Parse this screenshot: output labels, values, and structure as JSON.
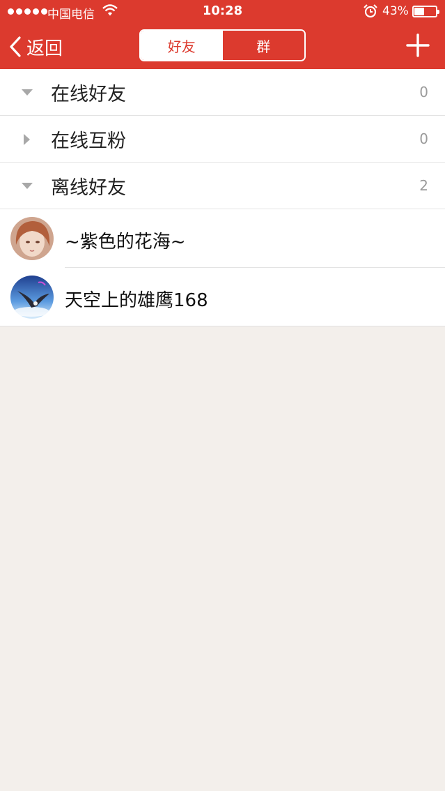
{
  "status": {
    "carrier": "中国电信",
    "time": "10:28",
    "battery": "43%",
    "battery_level": 0.43
  },
  "nav": {
    "back_label": "返回",
    "tabs": [
      {
        "label": "好友",
        "active": true
      },
      {
        "label": "群",
        "active": false
      }
    ]
  },
  "groups": [
    {
      "name": "在线好友",
      "count": "0",
      "expanded": true
    },
    {
      "name": "在线互粉",
      "count": "0",
      "expanded": false
    },
    {
      "name": "离线好友",
      "count": "2",
      "expanded": true
    }
  ],
  "friends": [
    {
      "name": "~紫色的花海~"
    },
    {
      "name": "天空上的雄鹰168"
    }
  ],
  "colors": {
    "brand_red": "#dc3a2e",
    "background": "#f3efeb"
  }
}
